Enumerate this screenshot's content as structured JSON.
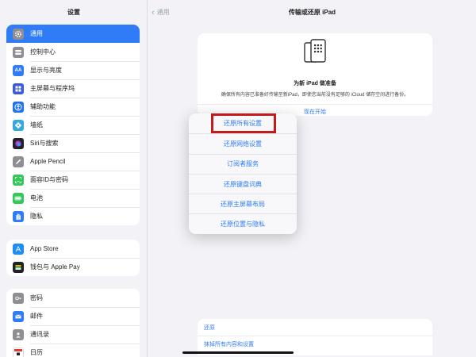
{
  "sidebar": {
    "title": "设置",
    "groups": [
      [
        {
          "label": "通用",
          "icon": "gear-icon",
          "color": "#8e8e93",
          "selected": true
        },
        {
          "label": "控制中心",
          "icon": "toggles-icon",
          "color": "#8e8e93"
        },
        {
          "label": "显示与亮度",
          "icon": "aa-icon",
          "color": "#2f7cf6"
        },
        {
          "label": "主屏幕与程序坞",
          "icon": "grid-icon",
          "color": "#3b5bdb"
        },
        {
          "label": "辅助功能",
          "icon": "accessibility-icon",
          "color": "#1f74e8"
        },
        {
          "label": "墙纸",
          "icon": "flower-icon",
          "color": "#35a8e0"
        },
        {
          "label": "Siri与搜索",
          "icon": "siri-icon",
          "color": "#222"
        },
        {
          "label": "Apple Pencil",
          "icon": "pencil-icon",
          "color": "#8e8e93"
        },
        {
          "label": "面容ID与密码",
          "icon": "faceid-icon",
          "color": "#34c759"
        },
        {
          "label": "电池",
          "icon": "battery-icon",
          "color": "#34c759"
        },
        {
          "label": "隐私",
          "icon": "hand-icon",
          "color": "#2f7cf6"
        }
      ],
      [
        {
          "label": "App Store",
          "icon": "appstore-icon",
          "color": "#1e8ef5"
        },
        {
          "label": "钱包与 Apple Pay",
          "icon": "wallet-icon",
          "color": "#222"
        }
      ],
      [
        {
          "label": "密码",
          "icon": "key-icon",
          "color": "#8e8e93"
        },
        {
          "label": "邮件",
          "icon": "mail-icon",
          "color": "#2f7cf6"
        },
        {
          "label": "通讯录",
          "icon": "contacts-icon",
          "color": "#8e8e93"
        },
        {
          "label": "日历",
          "icon": "calendar-icon",
          "color": "#ffffff"
        }
      ]
    ]
  },
  "header": {
    "back_label": "通用",
    "title": "传输或还原 iPad"
  },
  "prepare_card": {
    "icon": "ipad-apps-icon",
    "title": "为新 iPad 做准备",
    "description": "确保所有内容已准备好传输至新iPad，即使您当前没有足够的 iCloud 储存空间进行备份。",
    "link": "现在开始"
  },
  "reset_menu": {
    "options": [
      "还原所有设置",
      "还原网络设置",
      "订阅者服务",
      "还原键盘词典",
      "还原主屏幕布局",
      "还原位置与隐私"
    ],
    "highlight_color": "#c21b1b"
  },
  "bottom_card": {
    "rows": [
      "还原",
      "抹掉所有内容和设置"
    ]
  },
  "colors": {
    "accent": "#2f7cf6",
    "background": "#f2f2f7"
  }
}
